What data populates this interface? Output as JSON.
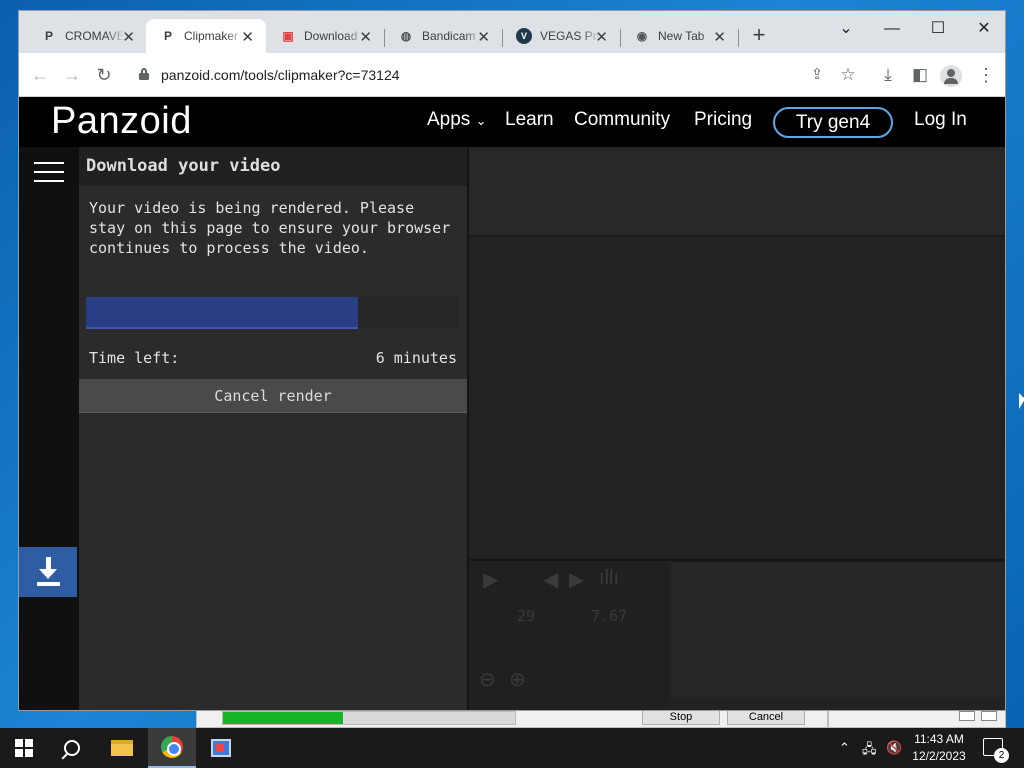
{
  "browser": {
    "tabs": [
      {
        "title": "CROMAVE",
        "favicon": "panzoid-logo-icon",
        "active": false
      },
      {
        "title": "Clipmaker",
        "favicon": "panzoid-logo-icon",
        "active": true
      },
      {
        "title": "Download",
        "favicon": "download-site-icon",
        "active": false
      },
      {
        "title": "Bandicam",
        "favicon": "globe-icon",
        "active": false
      },
      {
        "title": "VEGAS Pro",
        "favicon": "vegas-logo-icon",
        "active": false
      },
      {
        "title": "New Tab",
        "favicon": "chrome-icon",
        "active": false
      }
    ],
    "url": "panzoid.com/tools/clipmaker?c=73124"
  },
  "site": {
    "logo": "Panzoid",
    "nav": {
      "apps": "Apps",
      "learn": "Learn",
      "community": "Community",
      "pricing": "Pricing",
      "try": "Try gen4",
      "login": "Log In"
    }
  },
  "render_panel": {
    "title": "Download your video",
    "message": "Your video is being rendered. Please stay on this page to ensure your browser continues to process the video.",
    "progress": 0.73,
    "time_left_label": "Time left:",
    "time_left_value": "6 minutes",
    "cancel_label": "Cancel render"
  },
  "player": {
    "current_time": "29",
    "total_time": "7.67"
  },
  "bandicam": {
    "progress": 0.41,
    "stop_label": "Stop",
    "cancel_label": "Cancel"
  },
  "taskbar": {
    "time": "11:43 AM",
    "date": "12/2/2023",
    "notifications": "2"
  },
  "colors": {
    "accent_blue": "#2f5da3",
    "progress_fill": "#2a3e86",
    "try_border": "#5fa8e8"
  }
}
